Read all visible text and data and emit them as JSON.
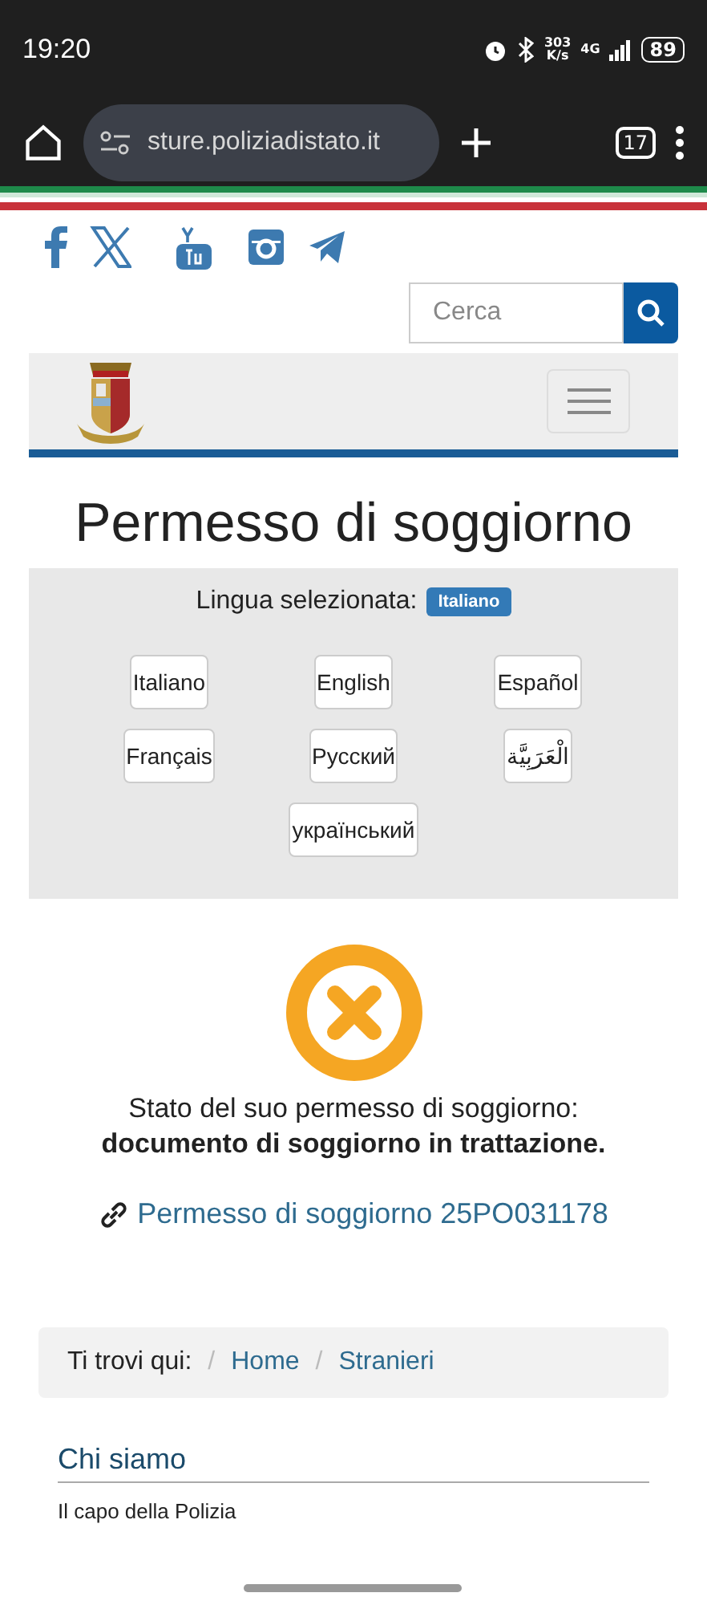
{
  "status_bar": {
    "time": "19:20",
    "speed_value": "303",
    "speed_unit": "K/s",
    "network": "4G",
    "battery": "89"
  },
  "browser": {
    "url": "sture.poliziadistato.it",
    "tab_count": "17"
  },
  "search": {
    "placeholder": "Cerca"
  },
  "page_title": "Permesso di soggiorno",
  "language": {
    "label": "Lingua selezionata:",
    "selected": "Italiano",
    "options": [
      "Italiano",
      "English",
      "Español",
      "Français",
      "Русский",
      "الْعَرَبِيَّة",
      "український"
    ]
  },
  "status": {
    "text": "Stato del suo permesso di soggiorno:",
    "value": "documento di soggiorno in trattazione.",
    "link": "Permesso di soggiorno 25PO031178"
  },
  "breadcrumb": {
    "label": "Ti trovi qui:",
    "items": [
      {
        "separator": "/",
        "label": "Home"
      },
      {
        "separator": "/",
        "label": "Stranieri"
      }
    ]
  },
  "section": {
    "heading": "Chi siamo",
    "items": [
      "Il capo della Polizia"
    ]
  }
}
